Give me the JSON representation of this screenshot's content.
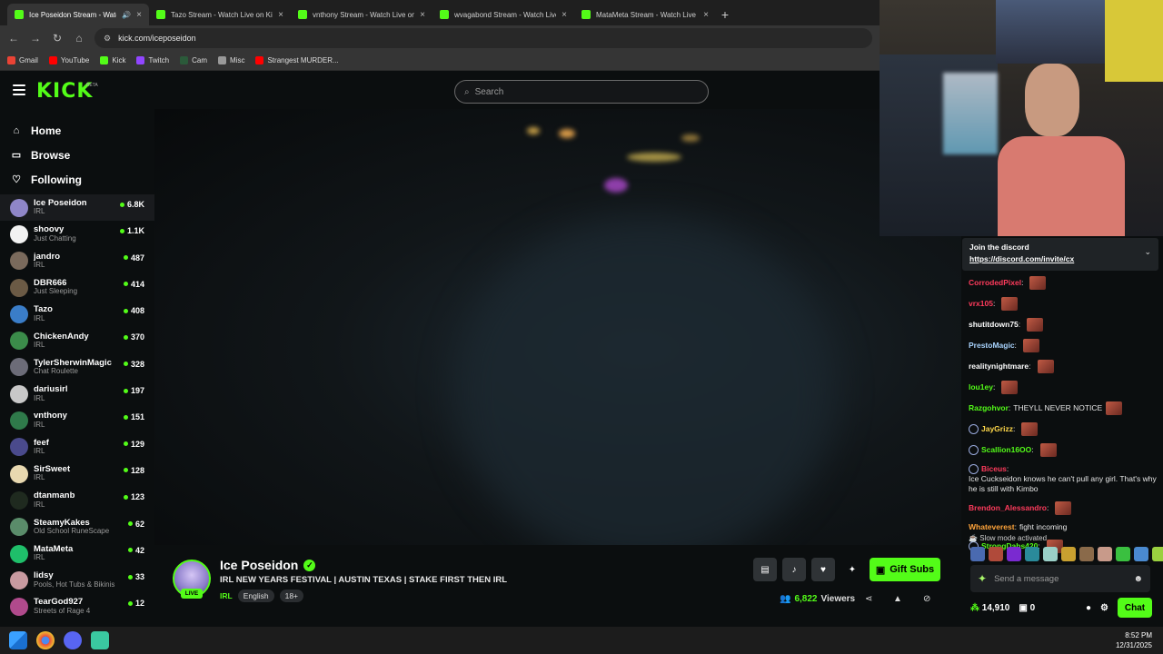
{
  "browser": {
    "tabs": [
      {
        "title": "Ice Poseidon Stream - Watch",
        "active": true,
        "color": "#53fc18"
      },
      {
        "title": "Tazo Stream - Watch Live on Kick",
        "active": false,
        "color": "#53fc18"
      },
      {
        "title": "vnthony Stream - Watch Live on",
        "active": false,
        "color": "#53fc18"
      },
      {
        "title": "wvagabond Stream - Watch Live",
        "active": false,
        "color": "#53fc18"
      },
      {
        "title": "MataMeta Stream - Watch Live",
        "active": false,
        "color": "#53fc18"
      }
    ],
    "url": "kick.com/iceposeidon",
    "bookmarks": [
      {
        "label": "Gmail",
        "color": "#ea4335"
      },
      {
        "label": "YouTube",
        "color": "#ff0000"
      },
      {
        "label": "Kick",
        "color": "#53fc18"
      },
      {
        "label": "Twitch",
        "color": "#9146ff"
      },
      {
        "label": "Cam",
        "color": "#2b5a3a"
      },
      {
        "label": "Misc",
        "color": "#999999"
      },
      {
        "label": "Strangest MURDER...",
        "color": "#ff0000"
      }
    ]
  },
  "header": {
    "logo": "KICK",
    "beta": "BETA",
    "search_placeholder": "Search"
  },
  "sidebar": {
    "nav": [
      {
        "label": "Home",
        "icon": "⌂"
      },
      {
        "label": "Browse",
        "icon": "▭"
      },
      {
        "label": "Following",
        "icon": "♡"
      }
    ],
    "channels": [
      {
        "name": "Ice Poseidon",
        "category": "IRL",
        "viewers": "6.8K",
        "color": "#8f86c8"
      },
      {
        "name": "shoovy",
        "category": "Just Chatting",
        "viewers": "1.1K",
        "color": "#f2f2f2"
      },
      {
        "name": "jandro",
        "category": "IRL",
        "viewers": "487",
        "color": "#7a6a5c"
      },
      {
        "name": "DBR666",
        "category": "Just Sleeping",
        "viewers": "414",
        "color": "#6b5a45"
      },
      {
        "name": "Tazo",
        "category": "IRL",
        "viewers": "408",
        "color": "#3a7dc8"
      },
      {
        "name": "ChickenAndy",
        "category": "IRL",
        "viewers": "370",
        "color": "#3b8c4a"
      },
      {
        "name": "TylerSherwinMagic",
        "category": "Chat Roulette",
        "viewers": "328",
        "color": "#6c6c78"
      },
      {
        "name": "dariusirl",
        "category": "IRL",
        "viewers": "197",
        "color": "#c8c8c8"
      },
      {
        "name": "vnthony",
        "category": "IRL",
        "viewers": "151",
        "color": "#2f7a4a"
      },
      {
        "name": "feef",
        "category": "IRL",
        "viewers": "129",
        "color": "#4a4a8c"
      },
      {
        "name": "SirSweet",
        "category": "IRL",
        "viewers": "128",
        "color": "#e8d8b0"
      },
      {
        "name": "dtanmanb",
        "category": "IRL",
        "viewers": "123",
        "color": "#1f2a1f"
      },
      {
        "name": "SteamyKakes",
        "category": "Old School RuneScape",
        "viewers": "62",
        "color": "#5a8c6a"
      },
      {
        "name": "MataMeta",
        "category": "IRL",
        "viewers": "42",
        "color": "#1fbf6a"
      },
      {
        "name": "lidsy",
        "category": "Pools, Hot Tubs & Bikinis",
        "viewers": "33",
        "color": "#c89aa0"
      },
      {
        "name": "TearGod927",
        "category": "Streets of Rage 4",
        "viewers": "12",
        "color": "#b04a8c"
      }
    ]
  },
  "stream": {
    "name": "Ice Poseidon",
    "live": "LIVE",
    "title": "IRL NEW YEARS FESTIVAL | AUSTIN TEXAS | STAKE FIRST THEN IRL",
    "category": "IRL",
    "tags": [
      "English",
      "18+"
    ],
    "viewers": "6,822",
    "viewers_label": "Viewers",
    "gift_label": "Gift Subs"
  },
  "chat": {
    "pinned_title": "Join the discord",
    "pinned_link": "https://discord.com/invite/cx",
    "messages": [
      {
        "user": "CorrodedPixel",
        "color": "#ff3b5c",
        "text": "",
        "emote": true,
        "badge": false
      },
      {
        "user": "vrx105",
        "color": "#ff3b5c",
        "text": "",
        "emote": true,
        "badge": false
      },
      {
        "user": "shutitdown75",
        "color": "#ffffff",
        "text": "",
        "emote": true,
        "badge": false
      },
      {
        "user": "PrestoMagic",
        "color": "#a9d4ff",
        "text": "",
        "emote": true,
        "badge": false
      },
      {
        "user": "realitynightmare",
        "color": "#ffffff",
        "text": "",
        "emote": true,
        "badge": false
      },
      {
        "user": "lou1ey",
        "color": "#53fc18",
        "text": "",
        "emote": true,
        "badge": false
      },
      {
        "user": "Razgohvor",
        "color": "#53fc18",
        "text": "THEYLL NEVER NOTICE",
        "emote": true,
        "badge": false
      },
      {
        "user": "JayGrizz",
        "color": "#ffd84a",
        "text": "",
        "emote": true,
        "badge": true
      },
      {
        "user": "Scallion16OO",
        "color": "#53fc18",
        "text": "",
        "emote": true,
        "badge": true
      },
      {
        "user": "Biceus",
        "color": "#ff3b5c",
        "text": "Ice Cuckseidon knows he can't pull any girl. That's why he is still with Kimbo",
        "emote": false,
        "badge": true
      },
      {
        "user": "Brendon_Alessandro",
        "color": "#ff3b5c",
        "text": "",
        "emote": true,
        "badge": false
      },
      {
        "user": "Whateverest",
        "color": "#ffa43a",
        "text": "fight incoming",
        "emote": false,
        "badge": false
      },
      {
        "user": "StrongDabs420",
        "color": "#53fc18",
        "text": "",
        "emote": true,
        "badge": true
      }
    ],
    "slow_mode": "Slow mode activated",
    "input_placeholder": "Send a message",
    "points": "14,910",
    "count": "0",
    "send_label": "Chat"
  },
  "taskbar": {
    "time": "8:52 PM",
    "date": "12/31/2025"
  }
}
